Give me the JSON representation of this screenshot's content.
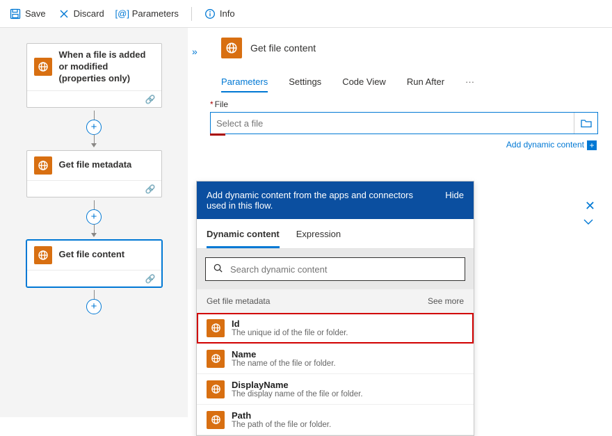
{
  "toolbar": {
    "save": "Save",
    "discard": "Discard",
    "parameters": "Parameters",
    "info": "Info"
  },
  "flow": {
    "cards": [
      {
        "label": "When a file is added or modified (properties only)"
      },
      {
        "label": "Get file metadata"
      },
      {
        "label": "Get file content"
      }
    ]
  },
  "panel": {
    "title": "Get file content",
    "tabs": {
      "parameters": "Parameters",
      "settings": "Settings",
      "codeview": "Code View",
      "runafter": "Run After"
    },
    "file_label": "File",
    "file_placeholder": "Select a file",
    "add_dynamic": "Add dynamic content"
  },
  "dyn": {
    "head": "Add dynamic content from the apps and connectors used in this flow.",
    "hide": "Hide",
    "tabs": {
      "dynamic": "Dynamic content",
      "expression": "Expression"
    },
    "search_placeholder": "Search dynamic content",
    "group": "Get file metadata",
    "seemore": "See more",
    "items": [
      {
        "name": "Id",
        "desc": "The unique id of the file or folder."
      },
      {
        "name": "Name",
        "desc": "The name of the file or folder."
      },
      {
        "name": "DisplayName",
        "desc": "The display name of the file or folder."
      },
      {
        "name": "Path",
        "desc": "The path of the file or folder."
      }
    ]
  }
}
